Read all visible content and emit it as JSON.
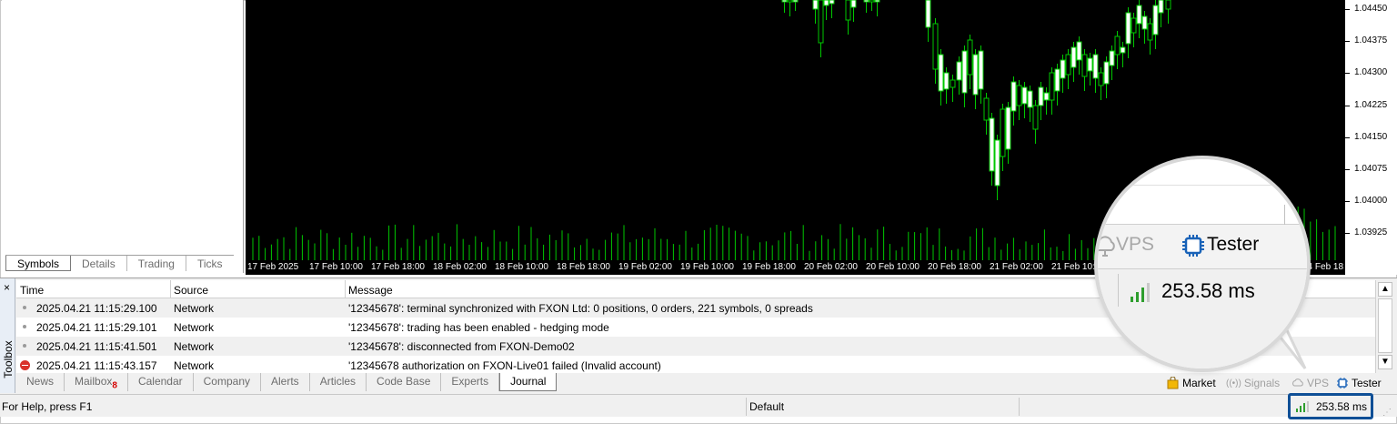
{
  "market_watch": {
    "tabs": [
      "Symbols",
      "Details",
      "Trading",
      "Ticks"
    ],
    "active_tab": "Symbols"
  },
  "chart": {
    "price_labels": [
      "1.04450",
      "1.04375",
      "1.04300",
      "1.04225",
      "1.04150",
      "1.04075",
      "1.04000",
      "1.03925"
    ],
    "time_labels": [
      "17 Feb 2025",
      "17 Feb 10:00",
      "17 Feb 18:00",
      "18 Feb 02:00",
      "18 Feb 10:00",
      "18 Feb 18:00",
      "19 Feb 02:00",
      "19 Feb 10:00",
      "19 Feb 18:00",
      "20 Feb 02:00",
      "20 Feb 10:00",
      "20 Feb 18:00",
      "21 Feb 02:00",
      "21 Feb 10:00",
      "24 Feb 18:00"
    ],
    "colors": {
      "background": "#000000",
      "bull": "#ffffff",
      "bear": "#000000",
      "wick": "#00c800",
      "volume": "#00c800"
    }
  },
  "toolbox": {
    "close_label": "×",
    "side_label": "Toolbox",
    "columns": {
      "time": "Time",
      "source": "Source",
      "message": "Message"
    },
    "rows": [
      {
        "icon": "info-dot",
        "time": "2025.04.21 11:15:29.100",
        "source": "Network",
        "message": "'12345678': terminal synchronized with FXON Ltd: 0 positions, 0 orders, 221 symbols, 0 spreads"
      },
      {
        "icon": "info-dot",
        "time": "2025.04.21 11:15:29.101",
        "source": "Network",
        "message": "'12345678': trading has been enabled - hedging mode"
      },
      {
        "icon": "info-dot",
        "time": "2025.04.21 11:15:41.501",
        "source": "Network",
        "message": "'12345678': disconnected from FXON-Demo02"
      },
      {
        "icon": "error-icon",
        "time": "2025.04.21 11:15:43.157",
        "source": "Network",
        "message": "'12345678 authorization on FXON-Live01 failed (Invalid account)"
      }
    ],
    "tabs": [
      {
        "label": "News",
        "badge": ""
      },
      {
        "label": "Mailbox",
        "badge": "8"
      },
      {
        "label": "Calendar",
        "badge": ""
      },
      {
        "label": "Company",
        "badge": ""
      },
      {
        "label": "Alerts",
        "badge": ""
      },
      {
        "label": "Articles",
        "badge": ""
      },
      {
        "label": "Code Base",
        "badge": ""
      },
      {
        "label": "Experts",
        "badge": ""
      },
      {
        "label": "Journal",
        "badge": ""
      }
    ],
    "active_tab": "Journal",
    "right_buttons": {
      "market": "Market",
      "signals": "Signals",
      "vps": "VPS",
      "tester": "Tester"
    }
  },
  "status_bar": {
    "help": "For Help, press F1",
    "profile": "Default",
    "ping": "253.58 ms"
  },
  "magnifier": {
    "vps": "VPS",
    "tester": "Tester",
    "ping": "253.58 ms"
  }
}
